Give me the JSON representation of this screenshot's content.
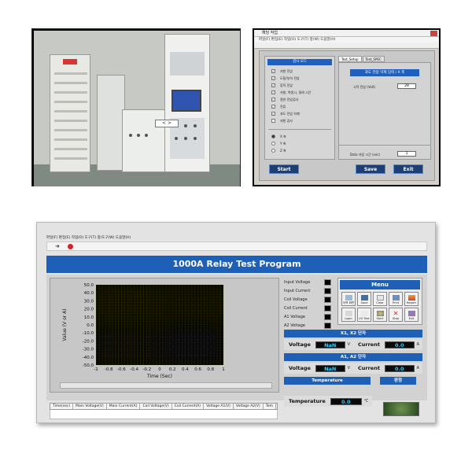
{
  "photo": {
    "tag_label": "<  >"
  },
  "setup_dialog": {
    "title": "해당 작업",
    "menu": "파일(F)   편집(E)   작업(O)   도구(T)   창(W)   도움말(H)",
    "left_header": "검사 모드",
    "checks": [
      {
        "label": "저항 전압",
        "checked": true
      },
      {
        "label": "도통/부하 전압",
        "checked": true
      },
      {
        "label": "동작 전압",
        "checked": true
      },
      {
        "label": "저항, 복원시, 릴레 시간",
        "checked": true
      },
      {
        "label": "절연 전압검사",
        "checked": true
      },
      {
        "label": "전류",
        "checked": true
      },
      {
        "label": "과도 전압 차폐",
        "checked": true
      },
      {
        "label": "저항 검사",
        "checked": false
      }
    ],
    "radios": [
      "X 축",
      "Y 축",
      "Z 축"
    ],
    "tabs": [
      "Test_Setup",
      "Test_SPEC"
    ],
    "banner": "과도 전압 억제 입력 / X 축",
    "field1_label": "시작 전압 (Volt)",
    "field1_value": "28",
    "field2_label": "Data 저장 시간 (sec)",
    "field2_value": "1",
    "buttons": {
      "start": "Start",
      "save": "Save",
      "exit": "Exit"
    }
  },
  "main_window": {
    "menubar": "파일(F)   편집(E)   작업(O)   도구(T)   창/도구(W)   도움말(H)",
    "title": "1000A Relay Test Program",
    "legend": [
      {
        "label": "Input Voltage",
        "color": "#000000"
      },
      {
        "label": "Input Current",
        "color": "#000000"
      },
      {
        "label": "Coil Voltage",
        "color": "#000000"
      },
      {
        "label": "Coil Current",
        "color": "#000000"
      },
      {
        "label": "A1 Voltage",
        "color": "#000000"
      },
      {
        "label": "A2 Voltage",
        "color": "#000000"
      }
    ],
    "menu": {
      "header": "Menu",
      "buttons": [
        {
          "label": "이력 화면",
          "icon": "history-icon"
        },
        {
          "label": "Save",
          "icon": "save-icon"
        },
        {
          "label": "Clear",
          "icon": "clear-icon"
        },
        {
          "label": "Print",
          "icon": "print-icon"
        },
        {
          "label": "Report",
          "icon": "report-icon"
        },
        {
          "label": "Login",
          "icon": "login-icon"
        },
        {
          "label": "I/O Test",
          "icon": "io-test-icon"
        },
        {
          "label": "Start",
          "icon": "start-icon"
        },
        {
          "label": "Stop",
          "icon": "stop-icon"
        },
        {
          "label": "Exit",
          "icon": "exit-icon"
        }
      ]
    },
    "x1x2": {
      "header": "X1, X2 단자",
      "voltage_label": "Voltage",
      "voltage_value": "NaN",
      "voltage_unit": "V",
      "current_label": "Current",
      "current_value": "0.0",
      "current_unit": "A"
    },
    "a1a2": {
      "header": "A1, A2 단자",
      "voltage_label": "Voltage",
      "voltage_value": "NaN",
      "voltage_unit": "V",
      "current_label": "Current",
      "current_value": "0.0",
      "current_unit": "A"
    },
    "temperature": {
      "header": "Temperature",
      "label": "Temperature",
      "value": "0.0",
      "unit": "℃"
    },
    "status_header": "판정",
    "table_columns": [
      "Time(sec)",
      "Main Voltage(V)",
      "Main Current(A)",
      "Coil Voltage(V)",
      "Coil Current(A)",
      "Voltage A1(V)",
      "Voltage A2(V)",
      "Tem"
    ]
  },
  "chart_data": {
    "type": "line",
    "xlabel": "Time (Sec)",
    "ylabel": "Value (V or A)",
    "xlim": [
      -1,
      1
    ],
    "ylim": [
      -50,
      50
    ],
    "x_ticks": [
      "-1",
      "-0.8",
      "-0.6",
      "-0.4",
      "-0.2",
      "0",
      "0.2",
      "0.4",
      "0.6",
      "0.8",
      "1"
    ],
    "y_ticks": [
      "50.0",
      "40.0",
      "30.0",
      "20.0",
      "10.0",
      "0.0",
      "-10.0",
      "-20.0",
      "-30.0",
      "-40.0",
      "-50.0"
    ],
    "grid": true,
    "plot_background": "#000000",
    "grid_color": "#8a8a00",
    "series": []
  }
}
